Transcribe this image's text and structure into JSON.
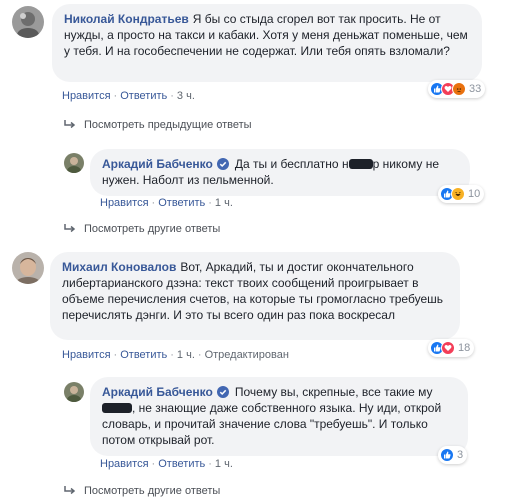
{
  "comments": [
    {
      "author": "Николай Кондратьев",
      "text": "Я бы со стыда сгорел вот так просить. Не от нужды, а просто на такси и кабаки. Хотя у меня деньжат поменьше, чем у тебя. И на гособеспечении не содержат. Или тебя опять взломали?",
      "like": "Нравится",
      "reply": "Ответить",
      "time": "3 ч.",
      "reactions_count": "33",
      "reactions": [
        "like-icon",
        "love-icon",
        "angry-icon"
      ]
    },
    {
      "author": "Аркадий Бабченко",
      "text_before": "Да ты и бесплатно н",
      "text_after": "р никому не нужен. Наболт из пельменной.",
      "like": "Нравится",
      "reply": "Ответить",
      "time": "1 ч.",
      "reactions_count": "10",
      "reactions": [
        "like-icon",
        "haha-icon"
      ]
    },
    {
      "author": "Михаил Коновалов",
      "text": "Вот, Аркадий, ты и достиг окончательного либертарианского дзэна: текст твоих сообщений проигрывает в объеме перечисления счетов, на которые ты громогласно требуешь перечислять дэнги. И это ты всего один раз пока воскресал",
      "like": "Нравится",
      "reply": "Ответить",
      "time": "1 ч.",
      "edited": "Отредактирован",
      "reactions_count": "18",
      "reactions": [
        "like-icon",
        "love-icon"
      ]
    },
    {
      "author": "Аркадий Бабченко",
      "text_before": "Почему вы, скрепные, все такие му",
      "text_after": ", не знающие даже собственного языка. Ну иди, открой словарь, и прочитай значение слова \"требуешь\". И только потом открывай рот.",
      "like": "Нравится",
      "reply": "Ответить",
      "time": "1 ч.",
      "reactions_count": "3",
      "reactions": [
        "like-icon"
      ]
    }
  ],
  "links": {
    "prev_replies": "Посмотреть предыдущие ответы",
    "other_replies_1": "Посмотреть другие ответы",
    "other_replies_2": "Посмотреть другие ответы"
  },
  "colors": {
    "link": "#385898",
    "bubble": "#f2f3f5",
    "like": "#1877f2",
    "love": "#f33e58",
    "haha": "#f7b125"
  }
}
